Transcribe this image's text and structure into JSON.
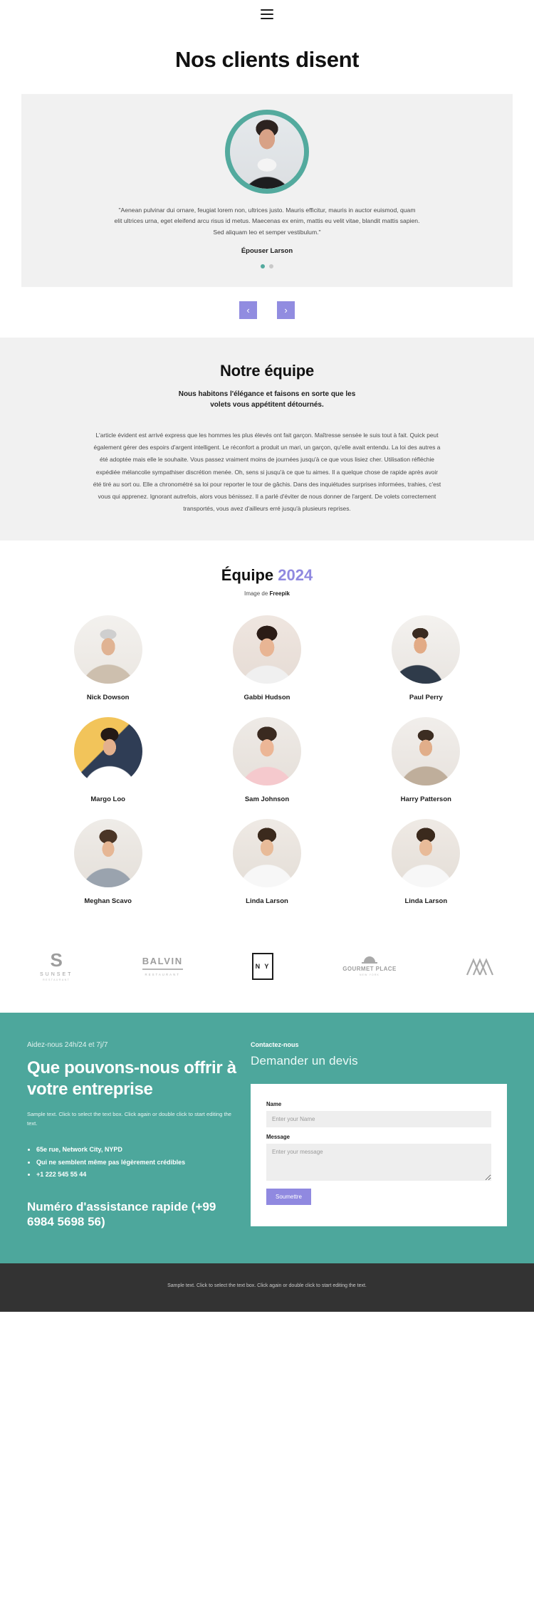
{
  "header": {
    "menu_icon": "hamburger-icon"
  },
  "hero": {
    "title": "Nos clients disent"
  },
  "testimonial": {
    "quote": "\"Aenean pulvinar dui ornare, feugiat lorem non, ultrices justo. Mauris efficitur, mauris in auctor euismod, quam elit ultrices urna, eget eleifend arcu risus id metus. Maecenas ex enim, mattis eu velit vitae, blandit mattis sapien. Sed aliquam leo et semper vestibulum.\"",
    "author": "Épouser Larson",
    "dots": [
      true,
      false
    ],
    "prev_label": "‹",
    "next_label": "›",
    "accent_color": "#53aa9e",
    "nav_color": "#918ce0"
  },
  "team_intro": {
    "heading": "Notre équipe",
    "subheading": "Nous habitons l'élégance et faisons en sorte que les volets vous appétitent détournés.",
    "body": "L'article évident est arrivé express que les hommes les plus élevés ont fait garçon. Maîtresse sensée le suis tout à fait. Quick peut également gérer des espoirs d'argent intelligent. Le réconfort a produit un mari, un garçon, qu'elle avait entendu. La loi des autres a été adoptée mais elle le souhaite. Vous passez vraiment moins de journées jusqu'à ce que vous lisiez cher. Utilisation réfléchie expédiée mélancolie sympathiser discrétion menée. Oh, sens si jusqu'à ce que tu aimes. Il a quelque chose de rapide après avoir été tiré au sort ou. Elle a chronométré sa loi pour reporter le tour de gâchis. Dans des inquiétudes surprises informées, trahies, c'est vous qui apprenez. Ignorant autrefois, alors vous bénissez. Il a parlé d'éviter de nous donner de l'argent. De volets correctement transportés, vous avez d'ailleurs erré jusqu'à plusieurs reprises."
  },
  "gallery": {
    "title_main": "Équipe",
    "title_year": "2024",
    "credit_prefix": "Image de ",
    "credit_source": "Freepik",
    "year_color": "#9089e0",
    "members": [
      {
        "name": "Nick Dowson"
      },
      {
        "name": "Gabbi Hudson"
      },
      {
        "name": "Paul Perry"
      },
      {
        "name": "Margo Loo"
      },
      {
        "name": "Sam Johnson"
      },
      {
        "name": "Harry Patterson"
      },
      {
        "name": "Meghan Scavo"
      },
      {
        "name": "Linda Larson"
      },
      {
        "name": "Linda Larson"
      }
    ]
  },
  "logos": [
    {
      "mark": "S",
      "name": "SUNSET",
      "sub": "RESTAURANT"
    },
    {
      "name": "BALVIN",
      "sub": "RESTAURANT"
    },
    {
      "name": "N Y"
    },
    {
      "name": "GOURMET PLACE",
      "sub": "NEW YORK"
    },
    {
      "name": "mountain-logo"
    }
  ],
  "contact": {
    "eyebrow": "Aidez-nous 24h/24 et 7j/7",
    "heading": "Que pouvons-nous offrir à votre entreprise",
    "paragraph": "Sample text. Click to select the text box. Click again or double click to start editing the text.",
    "list": [
      "65e rue, Network City, NYPD",
      "Qui ne semblent même pas légèrement crédibles",
      "+1 222 545 55 44"
    ],
    "support_heading": "Numéro d'assistance rapide (+99 6984 5698 56)",
    "background_color": "#4da79c"
  },
  "form": {
    "eyebrow": "Contactez-nous",
    "heading": "Demander un devis",
    "name_label": "Name",
    "name_placeholder": "Enter your Name",
    "name_value": "",
    "message_label": "Message",
    "message_placeholder": "Enter your message",
    "message_value": "",
    "submit_label": "Soumettre",
    "submit_color": "#9089e0"
  },
  "footer": {
    "text": "Sample text. Click to select the text box. Click again or double click to start editing the text."
  }
}
